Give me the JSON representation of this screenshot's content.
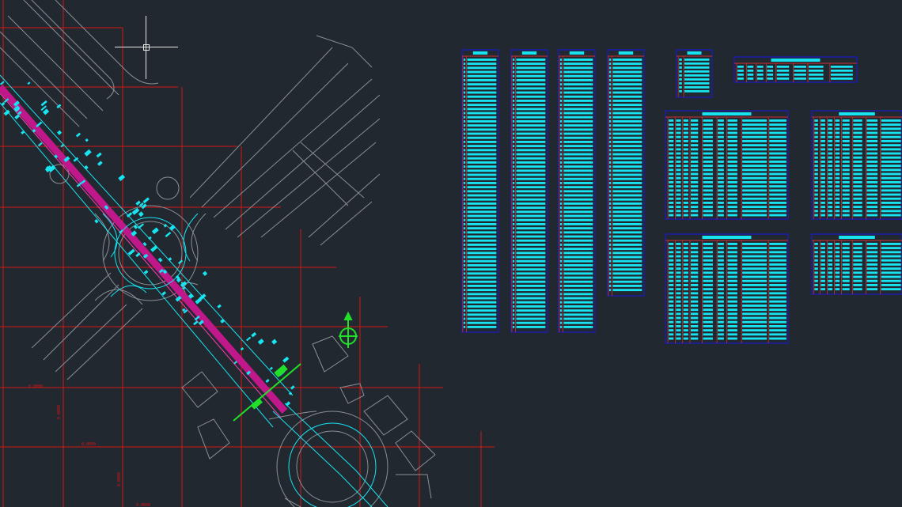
{
  "viewport": {
    "background": "#212830",
    "colors": {
      "grid": "#d81616",
      "road": "#8a8f96",
      "cyan": "#17e4f0",
      "magenta": "#c0178a",
      "green": "#22e02a",
      "table_border": "#1b1bc8",
      "table_line": "#cc3030"
    }
  },
  "grid_labels": [
    "0.0000",
    "0.0000",
    "0.0000",
    "0.0000",
    "0.0000"
  ],
  "cursor": {
    "icon": "crosshair-cursor-icon"
  },
  "north_arrow": {
    "icon": "compass-north-icon"
  }
}
